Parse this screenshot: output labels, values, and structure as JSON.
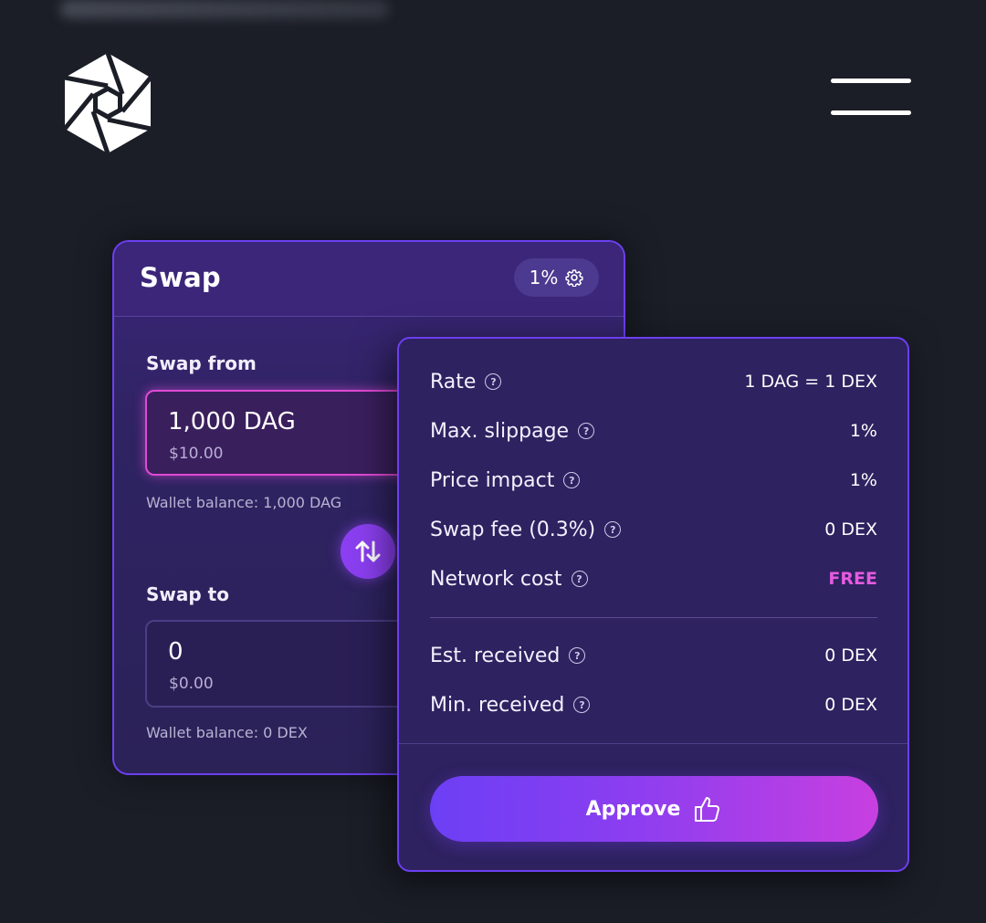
{
  "header": {
    "logo_icon": "hexagon-aperture-logo",
    "menu_icon": "hamburger-menu-icon"
  },
  "swap": {
    "title": "Swap",
    "slippage_pill": "1%",
    "settings_icon": "gear-icon",
    "from": {
      "label": "Swap from",
      "value": "1,000 DAG",
      "usd": "$10.00",
      "wallet_balance": "Wallet balance: 1,000 DAG"
    },
    "to": {
      "label": "Swap to",
      "value": "0",
      "usd": "$0.00",
      "wallet_balance": "Wallet balance: 0 DEX"
    },
    "switch_icon": "swap-arrows-icon"
  },
  "details": {
    "rows": [
      {
        "label": "Rate",
        "value": "1 DAG = 1 DEX"
      },
      {
        "label": "Max. slippage",
        "value": "1%"
      },
      {
        "label": "Price impact",
        "value": "1%"
      },
      {
        "label": "Swap fee (0.3%)",
        "value": "0 DEX"
      },
      {
        "label": "Network cost",
        "value": "FREE"
      }
    ],
    "summary": [
      {
        "label": "Est. received",
        "value": "0 DEX"
      },
      {
        "label": "Min. received",
        "value": "0 DEX"
      }
    ],
    "help_glyph": "?",
    "approve_label": "Approve",
    "approve_icon": "thumbs-up-icon"
  },
  "colors": {
    "background": "#1b1e27",
    "card": "#2e2260",
    "accent": "#8b3ff0",
    "free": "#e45be0"
  }
}
